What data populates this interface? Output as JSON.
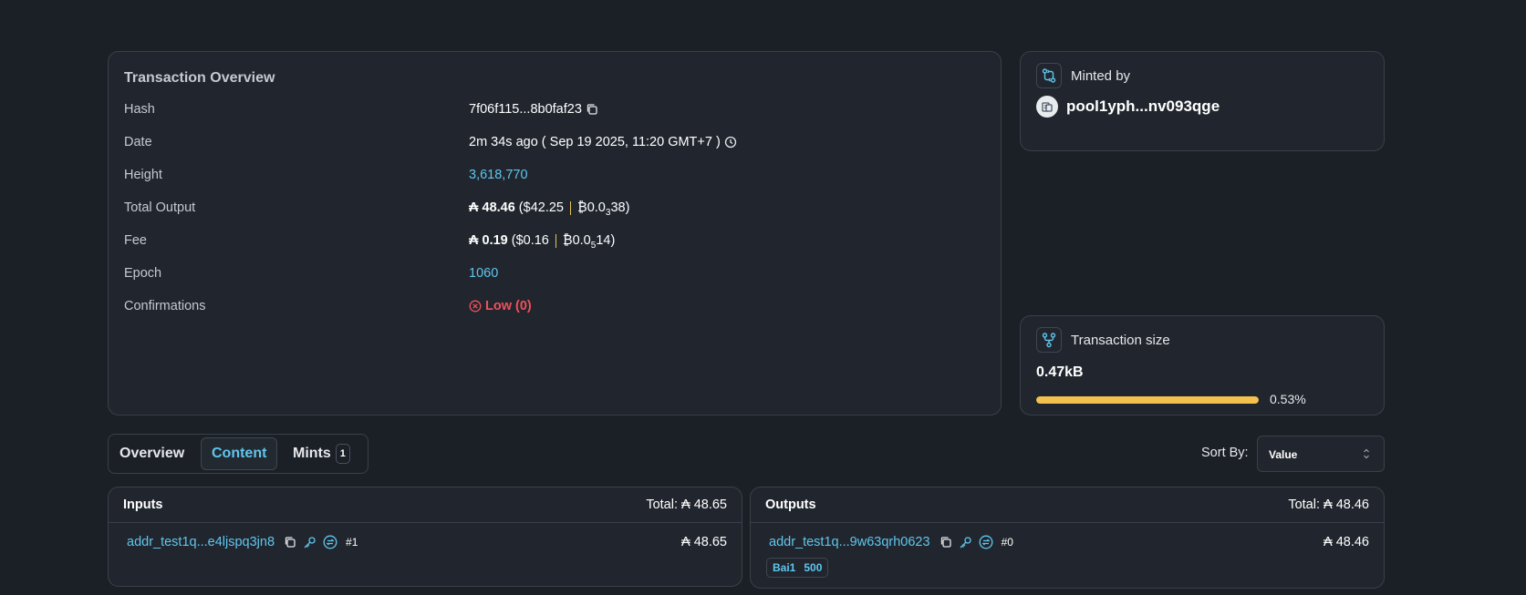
{
  "overview": {
    "title": "Transaction Overview",
    "rows": [
      {
        "label": "Hash",
        "value": "7f06f115...8b0faf23"
      },
      {
        "label": "Date",
        "value": "2m 34s ago ( Sep 19 2025, 11:20 GMT+7 )"
      },
      {
        "label": "Height",
        "value": "3,618,770"
      },
      {
        "label": "Total Output",
        "value": "₳ 48.46",
        "usd": "($42.25",
        "btc_prefix": "₿0.0",
        "btc_sub": "3",
        "btc_suffix": "38)"
      },
      {
        "label": "Fee",
        "value": "₳ 0.19",
        "usd": "($0.16",
        "btc_prefix": "₿0.0",
        "btc_sub": "5",
        "btc_suffix": "14)"
      },
      {
        "label": "Epoch",
        "value": "1060"
      },
      {
        "label": "Confirmations",
        "value": "Low (0)"
      }
    ]
  },
  "minted": {
    "title": "Minted by",
    "pool": "pool1yph...nv093qge"
  },
  "tx_size": {
    "title": "Transaction size",
    "value": "0.47kB",
    "percent": "0.53%",
    "bar_fill_fraction": 1.0
  },
  "tabs": [
    {
      "label": "Overview"
    },
    {
      "label": "Content",
      "active": true
    },
    {
      "label": "Mints",
      "badge": "1"
    }
  ],
  "sort": {
    "label": "Sort By:",
    "value": "Value"
  },
  "inputs": {
    "title": "Inputs",
    "total": "Total: ₳ 48.65",
    "items": [
      {
        "address": "addr_test1q...e4ljspq3jn8",
        "index": "#1",
        "amount": "₳ 48.65"
      }
    ]
  },
  "outputs": {
    "title": "Outputs",
    "total": "Total: ₳ 48.46",
    "items": [
      {
        "address": "addr_test1q...9w63qrh0623",
        "index": "#0",
        "amount": "₳ 48.46",
        "token_name": "Bai1",
        "token_qty": "500"
      }
    ]
  },
  "colors": {
    "accent": "#5fc6ee",
    "danger": "#f0505a",
    "progress": "#f2c14e",
    "background": "#1b1f26",
    "card": "#21262e"
  }
}
